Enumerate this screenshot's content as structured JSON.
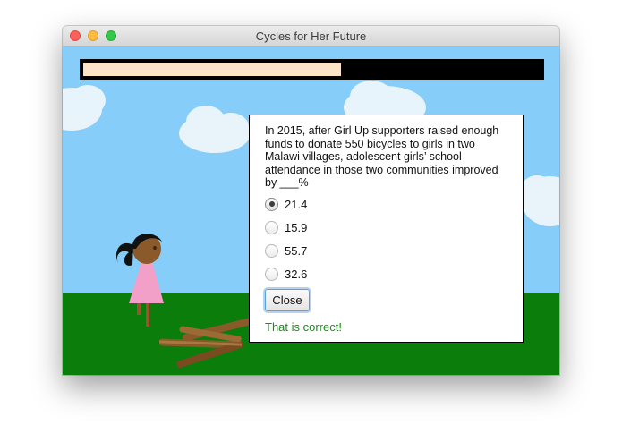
{
  "window": {
    "title": "Cycles for Her Future"
  },
  "progress": {
    "fraction": 0.564,
    "fill_color": "#fde4c7",
    "track_color": "#000000"
  },
  "quiz": {
    "question": "In 2015, after Girl Up supporters raised enough funds to donate 550 bicycles to girls in two Malawi villages, adolescent girls’ school attendance in those two communities improved by ___%",
    "options": [
      {
        "label": "21.4",
        "selected": true
      },
      {
        "label": "15.9",
        "selected": false
      },
      {
        "label": "55.7",
        "selected": false
      },
      {
        "label": "32.6",
        "selected": false
      }
    ],
    "close_label": "Close",
    "feedback": "That is correct!",
    "feedback_color": "#1b8a1b"
  },
  "scene": {
    "sky_color": "#86cdf9",
    "grass_color": "#0a7d0a",
    "character": "girl-character",
    "props": "wood-pile"
  }
}
